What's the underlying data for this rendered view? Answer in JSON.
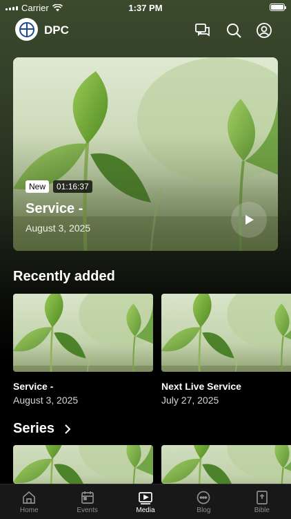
{
  "status_bar": {
    "carrier": "Carrier",
    "time": "1:37 PM"
  },
  "header": {
    "app_name": "DPC",
    "icons": [
      "chat-icon",
      "search-icon",
      "profile-icon"
    ]
  },
  "hero": {
    "badge_new": "New",
    "duration": "01:16:37",
    "title": "Service -",
    "date": "August 3, 2025"
  },
  "recently_added": {
    "title": "Recently added",
    "items": [
      {
        "title": "Service -",
        "date": "August 3, 2025"
      },
      {
        "title": "Next Live Service",
        "date": "July 27, 2025"
      }
    ]
  },
  "series": {
    "title": "Series"
  },
  "tabbar": {
    "active": "Media",
    "tabs": [
      {
        "label": "Home"
      },
      {
        "label": "Events"
      },
      {
        "label": "Media"
      },
      {
        "label": "Blog"
      },
      {
        "label": "Bible"
      }
    ]
  },
  "colors": {
    "background_top": "#3b4a2c",
    "background_bottom": "#000000",
    "tabbar": "#181818",
    "inactive_tab": "#8e8e8e"
  }
}
